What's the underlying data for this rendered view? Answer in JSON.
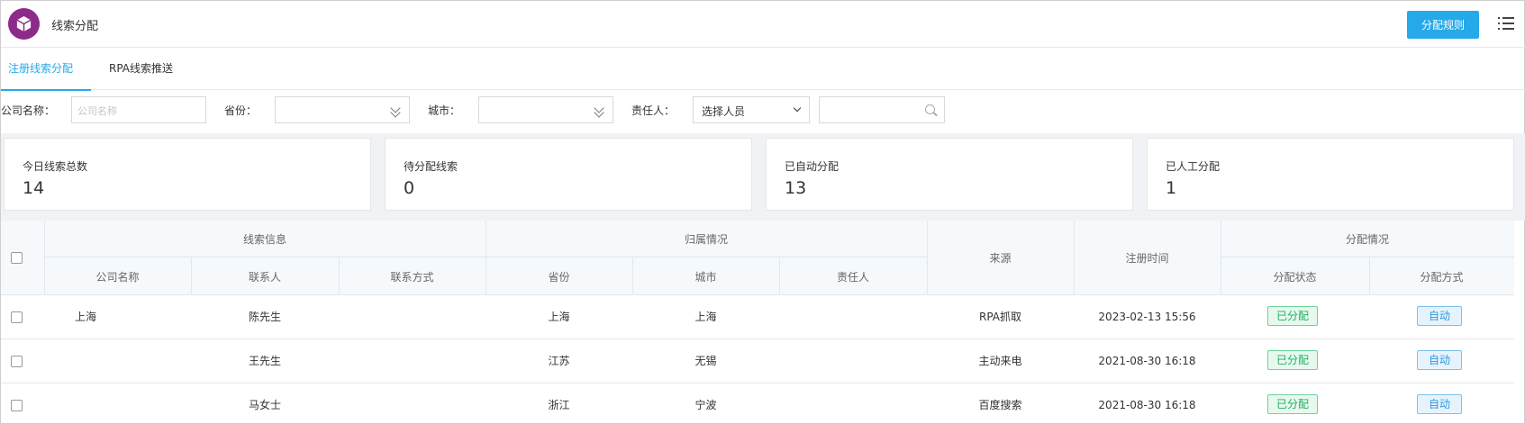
{
  "header": {
    "title": "线索分配",
    "rules_button": "分配规则"
  },
  "tabs": [
    {
      "label": "注册线索分配",
      "active": true
    },
    {
      "label": "RPA线索推送",
      "active": false
    }
  ],
  "filters": {
    "company_label": "公司名称：",
    "company_placeholder": "公司名称",
    "province_label": "省份：",
    "city_label": "城市：",
    "owner_label": "责任人：",
    "owner_value": "选择人员",
    "search_value": ""
  },
  "stats": [
    {
      "label": "今日线索总数",
      "value": "14"
    },
    {
      "label": "待分配线索",
      "value": "0"
    },
    {
      "label": "已自动分配",
      "value": "13"
    },
    {
      "label": "已人工分配",
      "value": "1"
    }
  ],
  "table": {
    "groups": {
      "lead_info": "线索信息",
      "ownership": "归属情况",
      "source": "来源",
      "reg_time": "注册时间",
      "assignment": "分配情况"
    },
    "columns": [
      "公司名称",
      "联系人",
      "联系方式",
      "省份",
      "城市",
      "责任人",
      "分配状态",
      "分配方式"
    ],
    "rows": [
      {
        "company": "上海",
        "contact": "陈先生",
        "phone": "",
        "province": "上海",
        "city": "上海",
        "owner": "",
        "source": "RPA抓取",
        "time": "2023-02-13 15:56",
        "status": "已分配",
        "method": "自动"
      },
      {
        "company": "",
        "contact": "王先生",
        "phone": "",
        "province": "江苏",
        "city": "无锡",
        "owner": "",
        "source": "主动来电",
        "time": "2021-08-30 16:18",
        "status": "已分配",
        "method": "自动"
      },
      {
        "company": "",
        "contact": "马女士",
        "phone": "",
        "province": "浙江",
        "city": "宁波",
        "owner": "",
        "source": "百度搜索",
        "time": "2021-08-30 16:18",
        "status": "已分配",
        "method": "自动"
      }
    ]
  },
  "colors": {
    "accent": "#26a9e8",
    "logo": "#8e2a8a",
    "success": "#20b062"
  }
}
